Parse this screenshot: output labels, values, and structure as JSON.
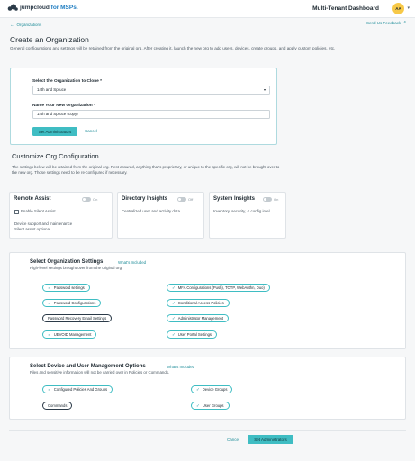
{
  "header": {
    "logo_brand": "jumpcloud",
    "logo_suffix": "for MSPs.",
    "title": "Multi-Tenant Dashboard",
    "avatar_initials": "AA"
  },
  "nav": {
    "back_label": "Organizations",
    "feedback_label": "Send Us Feedback"
  },
  "page": {
    "title": "Create an Organization",
    "description": "General configurations and settings will be retained from the original org. After creating it, launch the new org to add users, devices, create groups, and apply custom policies, etc."
  },
  "clone_form": {
    "clone_label": "Select the Organization to Clone *",
    "clone_value": "14th and Spruce",
    "name_label": "Name Your New Organization *",
    "name_value": "14th and Spruce (copy)",
    "primary_button": "Set Administrators",
    "cancel_button": "Cancel"
  },
  "customize": {
    "title": "Customize Org Configuration",
    "description": "The settings below will be retained from the original org. Rest assured, anything that's proprietary, or unique to the specific org, will not be brought over to the new org. Those settings need to be re-configured if necessary."
  },
  "feature_cards": [
    {
      "title": "Remote Assist",
      "toggle": "On",
      "checkbox": "Enable Silent Assist",
      "lines": [
        "Device support and maintenance",
        "Silent assist optional"
      ]
    },
    {
      "title": "Directory Insights",
      "toggle": "Off",
      "lines": [
        "Centralized user and activity data"
      ]
    },
    {
      "title": "System Insights",
      "toggle": "On",
      "lines": [
        "Inventory, security, & config intel"
      ]
    }
  ],
  "org_settings": {
    "title": "Select Organization Settings",
    "link": "What's Included",
    "subtitle": "High-level settings brought over from the original org.",
    "left": [
      {
        "label": "Password settings",
        "checked": true
      },
      {
        "label": "Password Configurations",
        "checked": true
      },
      {
        "label": "Password Recovery Email Settings",
        "checked": false
      },
      {
        "label": "UEVOID Management",
        "checked": true
      }
    ],
    "right": [
      {
        "label": "MFA Configurations (Push), TOTP, WebAuthn, Duo)",
        "checked": true
      },
      {
        "label": "Conditional Access Policies",
        "checked": true
      },
      {
        "label": "Administrator Management",
        "checked": true
      },
      {
        "label": "User Portal Settings",
        "checked": true
      }
    ]
  },
  "device_options": {
    "title": "Select Device and User Management Options",
    "link": "What's Included",
    "subtitle": "Files and sensitive information will not be carried over in Policies or Commands.",
    "left": [
      {
        "label": "Configured Policies And Groups",
        "checked": true
      },
      {
        "label": "Commands",
        "checked": false
      }
    ],
    "right": [
      {
        "label": "Device Groups",
        "checked": true
      },
      {
        "label": "User Groups",
        "checked": true
      }
    ]
  },
  "footer": {
    "cancel": "Cancel",
    "primary": "Set Administrators"
  },
  "colors": {
    "accent": "#3fbdc3",
    "link": "#1d8c98",
    "avatar": "#f7c948"
  }
}
